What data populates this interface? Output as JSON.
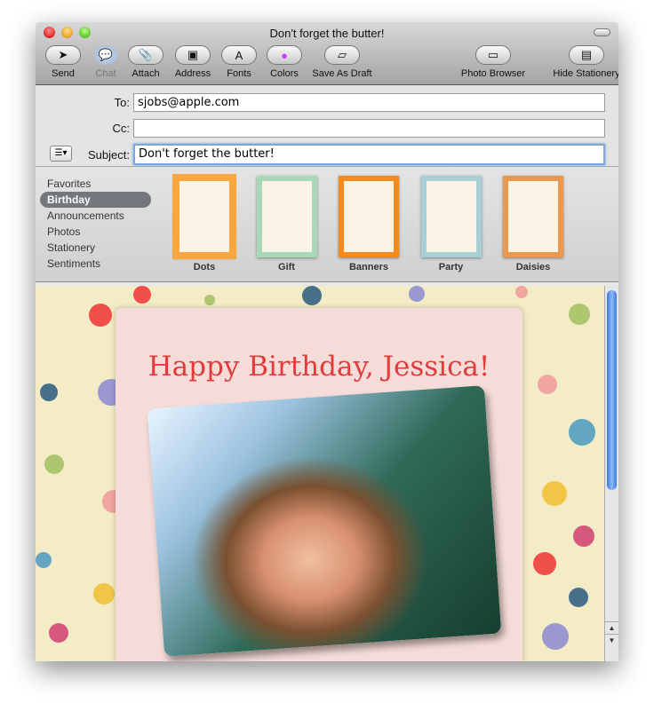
{
  "window": {
    "title": "Don't forget the butter!"
  },
  "toolbar": [
    {
      "label": "Send",
      "icon": "paper-plane-icon"
    },
    {
      "label": "Chat",
      "icon": "chat-bubble-icon",
      "disabled": true
    },
    {
      "label": "Attach",
      "icon": "paperclip-icon"
    },
    {
      "label": "Address",
      "icon": "address-book-icon"
    },
    {
      "label": "Fonts",
      "icon": "font-icon"
    },
    {
      "label": "Colors",
      "icon": "color-wheel-icon"
    },
    {
      "label": "Save As Draft",
      "icon": "draft-icon"
    },
    {
      "label": "Photo Browser",
      "icon": "photo-icon"
    },
    {
      "label": "Hide Stationery",
      "icon": "stationery-icon"
    }
  ],
  "header": {
    "to_label": "To:",
    "to_value": "sjobs@apple.com",
    "cc_label": "Cc:",
    "cc_value": "",
    "subject_label": "Subject:",
    "subject_value": "Don't forget the butter!"
  },
  "stationery": {
    "categories": [
      "Favorites",
      "Birthday",
      "Announcements",
      "Photos",
      "Stationery",
      "Sentiments"
    ],
    "selected": "Birthday",
    "templates": [
      {
        "name": "Dots",
        "color": "#f7a640"
      },
      {
        "name": "Gift",
        "color": "#a8d8b8"
      },
      {
        "name": "Banners",
        "color": "#f58a20"
      },
      {
        "name": "Party",
        "color": "#a8cfd6"
      },
      {
        "name": "Daisies",
        "color": "#ea9a50"
      }
    ]
  },
  "message": {
    "heading": "Happy Birthday, Jessica!",
    "heading_color": "#e03c3c"
  }
}
